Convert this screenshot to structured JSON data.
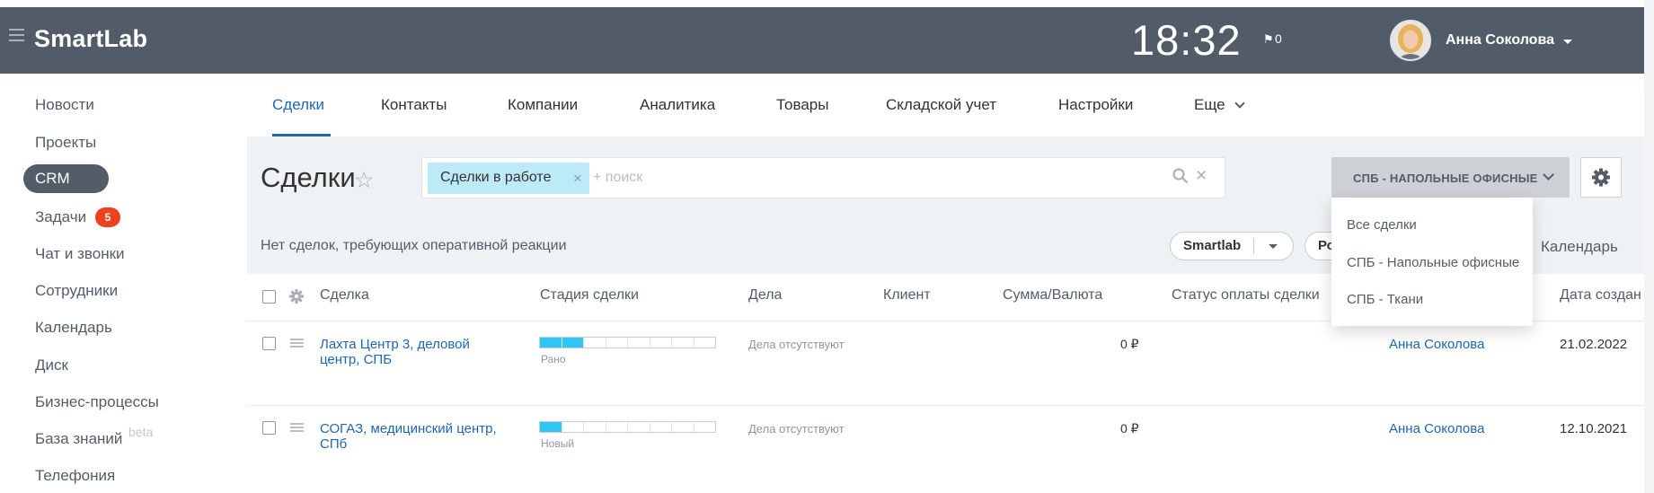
{
  "header": {
    "logo": "SmartLab",
    "clock": "18:32",
    "notifications_count": "0",
    "user_name": "Анна Соколова"
  },
  "sidebar": {
    "items": [
      {
        "label": "Новости"
      },
      {
        "label": "Проекты"
      },
      {
        "label": "CRM"
      },
      {
        "label": "Задачи",
        "badge": "5"
      },
      {
        "label": "Чат и звонки"
      },
      {
        "label": "Сотрудники"
      },
      {
        "label": "Календарь"
      },
      {
        "label": "Диск"
      },
      {
        "label": "Бизнес-процессы"
      },
      {
        "label": "База знаний",
        "tag": "beta"
      },
      {
        "label": "Телефония"
      }
    ]
  },
  "tabs": [
    {
      "label": "Сделки",
      "active": true
    },
    {
      "label": "Контакты"
    },
    {
      "label": "Компании"
    },
    {
      "label": "Аналитика"
    },
    {
      "label": "Товары"
    },
    {
      "label": "Складской учет"
    },
    {
      "label": "Настройки"
    },
    {
      "label": "Еще"
    }
  ],
  "page": {
    "title": "Сделки",
    "filter_chip": "Сделки в работе",
    "search_placeholder": "+ поиск",
    "category_button": "СПБ - НАПОЛЬНЫЕ ОФИСНЫЕ",
    "info_text": "Нет сделок, требующих оперативной реакции",
    "smartlab_filter": "Smartlab",
    "second_filter": "Ро",
    "calendar_link": "Календарь"
  },
  "dropdown": {
    "items": [
      "Все сделки",
      "СПБ - Напольные офисные",
      "СПБ - Ткани"
    ]
  },
  "table": {
    "columns": [
      "Сделка",
      "Стадия сделки",
      "Дела",
      "Клиент",
      "Сумма/Валюта",
      "Статус оплаты сделки",
      "Дата создан"
    ],
    "rows": [
      {
        "deal_line1": "Лахта Центр 3, деловой",
        "deal_line2": "центр, СПБ",
        "stage_label": "Рано",
        "stage_progress": 0.25,
        "tasks": "Дела отсутствуют",
        "amount": "0 ₽",
        "responsible": "Анна Соколова",
        "date": "21.02.2022"
      },
      {
        "deal_line1": "СОГАЗ, медицинский центр,",
        "deal_line2": "СПб",
        "stage_label": "Новый",
        "stage_progress": 0.125,
        "tasks": "Дела отсутствуют",
        "amount": "0 ₽",
        "responsible": "Анна Соколова",
        "date": "12.10.2021"
      }
    ]
  },
  "colors": {
    "header_bg": "#525c69",
    "accent": "#2067b0",
    "stage_fill": "#2fc6f6",
    "badge": "#f0411e",
    "chip_bg": "#bdeaf7"
  }
}
